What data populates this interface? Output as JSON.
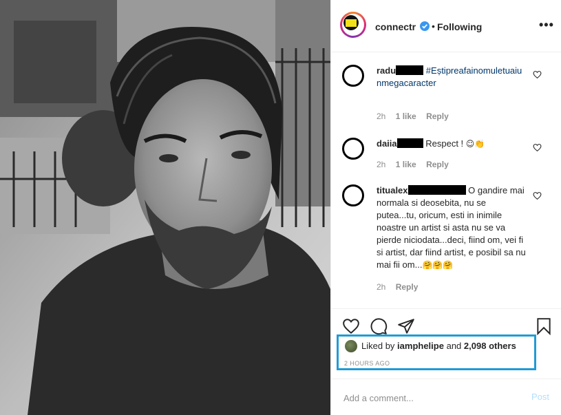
{
  "post": {
    "username": "connectr",
    "follow_status": "Following",
    "more_label": "•••"
  },
  "comments": [
    {
      "user": "radu",
      "text": "#Eștipreafainomuletuaiunmegacaracter",
      "time": "2h",
      "likes": "1 like",
      "reply": "Reply"
    },
    {
      "user": "daiia",
      "text": "Respect !",
      "emoji": "☺👏",
      "time": "2h",
      "likes": "1 like",
      "reply": "Reply"
    },
    {
      "user": "titualex",
      "text": "O gandire mai normala si deosebita, nu se putea...tu, oricum, esti in inimile noastre un artist si asta nu se va pierde niciodata...deci, fiind om, vei fi si artist, dar fiind artist, e posibil sa nu mai fii om...",
      "emoji": "🤗🤗🤗",
      "time": "2h",
      "reply": "Reply"
    }
  ],
  "likes": {
    "prefix": "Liked by",
    "user": "iamphelipe",
    "conj": "and",
    "count": "2,098 others"
  },
  "timestamp": "2 HOURS AGO",
  "add_comment": {
    "placeholder": "Add a comment...",
    "post_label": "Post"
  },
  "colors": {
    "highlight_box": "#1f9bd6",
    "verified": "#3897f0",
    "hashtag": "#00376b",
    "post_disabled": "#b2dffc"
  }
}
